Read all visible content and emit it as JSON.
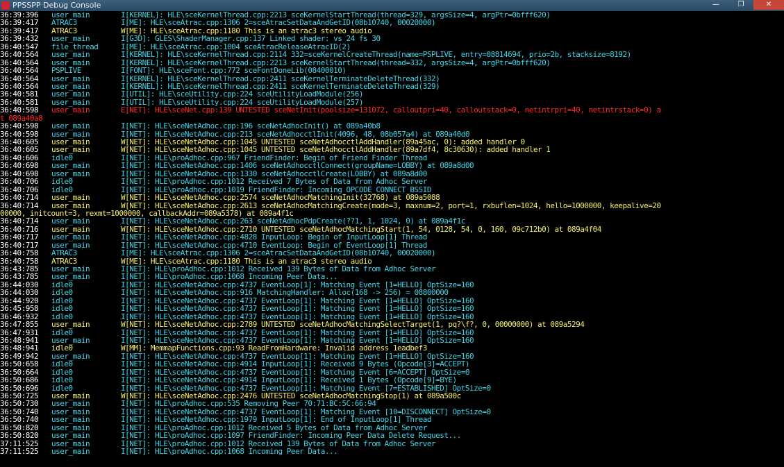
{
  "window": {
    "title": "PPSSPP Debug Console",
    "minimize": "—",
    "maximize": "❐",
    "close": "✕"
  },
  "colors": {
    "info": "#3fd5e8",
    "warning": "#f4f06a",
    "error": "#ff2a2a",
    "timestamp": "#ffffff",
    "background": "#000000"
  },
  "log": [
    {
      "ts": "36:39:396",
      "thread": "user_main",
      "msg": "I[KERNEL]: HLE\\sceKernelThread.cpp:2213 sceKernelStartThread(thread=329, argsSize=4, argPtr=0bfff620)",
      "level": "info"
    },
    {
      "ts": "36:39:417",
      "thread": "ATRAC3",
      "msg": "I[ME]: HLE\\sceAtrac.cpp:1306 2=sceAtracSetDataAndGetID(08b10740, 00020000)",
      "level": "info"
    },
    {
      "ts": "36:39:417",
      "thread": "ATRAC3",
      "msg": "W[ME]: HLE\\sceAtrac.cpp:1180 This is an atrac3 stereo audio",
      "level": "warn"
    },
    {
      "ts": "36:39:432",
      "thread": "user_main",
      "msg": "I[G3D]: GLES\\ShaderManager.cpp:137 Linked shader: vs 24 fs 30",
      "level": "info"
    },
    {
      "ts": "36:40:547",
      "thread": "file_thread",
      "msg": "I[ME]: HLE\\sceAtrac.cpp:1004 sceAtracReleaseAtracID(2)",
      "level": "info"
    },
    {
      "ts": "36:40:564",
      "thread": "user_main",
      "msg": "I[KERNEL]: HLE\\sceKernelThread.cpp:2114 332=sceKernelCreateThread(name=PSPLIVE, entry=08814694, prio=2b, stacksize=8192)",
      "level": "info"
    },
    {
      "ts": "36:40:564",
      "thread": "user_main",
      "msg": "I[KERNEL]: HLE\\sceKernelThread.cpp:2213 sceKernelStartThread(thread=332, argsSize=4, argPtr=0bfff620)",
      "level": "info"
    },
    {
      "ts": "36:40:564",
      "thread": "PSPLIVE",
      "msg": "I[FONT]: HLE\\sceFont.cpp:772 sceFontDoneLib(08400010)",
      "level": "info"
    },
    {
      "ts": "36:40:564",
      "thread": "user_main",
      "msg": "I[KERNEL]: HLE\\sceKernelThread.cpp:2411 sceKernelTerminateDeleteThread(332)",
      "level": "info"
    },
    {
      "ts": "36:40:564",
      "thread": "user_main",
      "msg": "I[KERNEL]: HLE\\sceKernelThread.cpp:2411 sceKernelTerminateDeleteThread(329)",
      "level": "info"
    },
    {
      "ts": "36:40:581",
      "thread": "user_main",
      "msg": "I[UTIL]: HLE\\sceUtility.cpp:224 sceUtilityLoadModule(256)",
      "level": "info"
    },
    {
      "ts": "36:40:581",
      "thread": "user_main",
      "msg": "I[UTIL]: HLE\\sceUtility.cpp:224 sceUtilityLoadModule(257)",
      "level": "info"
    },
    {
      "ts": "36:40:598",
      "thread": "user_main",
      "msg": "E[NET]: HLE\\sceNet.cpp:139 UNTESTED sceNetInit(poolsize=131072, calloutpri=40, calloutstack=0, netintrpri=40, netintrstack=0) a",
      "level": "err"
    },
    {
      "cont": "t 089a40a8",
      "level": "err"
    },
    {
      "ts": "36:40:598",
      "thread": "user_main",
      "msg": "I[NET]: HLE\\sceNetAdhoc.cpp:196 sceNetAdhocInit() at 089a40b8",
      "level": "info"
    },
    {
      "ts": "36:40:598",
      "thread": "user_main",
      "msg": "I[NET]: HLE\\sceNetAdhoc.cpp:213 sceNetAdhocctlInit(4096, 48, 08b057a4) at 089a40d0",
      "level": "info"
    },
    {
      "ts": "36:40:605",
      "thread": "user_main",
      "msg": "W[NET]: HLE\\sceNetAdhoc.cpp:1045 UNTESTED sceNetAdhocctlAddHandler(89a45ac, 0): added handler 0",
      "level": "warn"
    },
    {
      "ts": "36:40:605",
      "thread": "user_main",
      "msg": "W[NET]: HLE\\sceNetAdhoc.cpp:1045 UNTESTED sceNetAdhocctlAddHandler(89a7df4, 8c30630): added handler 1",
      "level": "warn"
    },
    {
      "ts": "36:40:606",
      "thread": "idle0",
      "msg": "I[NET]: HLE\\proAdhoc.cpp:967 FriendFinder: Begin of Friend Finder Thread",
      "level": "info"
    },
    {
      "ts": "36:40:698",
      "thread": "user_main",
      "msg": "I[NET]: HLE\\sceNetAdhoc.cpp:1406 sceNetAdhocctlConnect(groupName=LOBBY) at 089a8d00",
      "level": "info"
    },
    {
      "ts": "36:40:698",
      "thread": "user_main",
      "msg": "I[NET]: HLE\\sceNetAdhoc.cpp:1330 sceNetAdhocctlCreate(LOBBY) at 089a8d00",
      "level": "info"
    },
    {
      "ts": "36:40:706",
      "thread": "idle0",
      "msg": "I[NET]: HLE\\proAdhoc.cpp:1012 Received 7 Bytes of Data from Adhoc Server",
      "level": "info"
    },
    {
      "ts": "36:40:706",
      "thread": "idle0",
      "msg": "I[NET]: HLE\\proAdhoc.cpp:1019 FriendFinder: Incoming OPCODE_CONNECT_BSSID",
      "level": "info"
    },
    {
      "ts": "36:40:714",
      "thread": "user_main",
      "msg": "W[NET]: HLE\\sceNetAdhoc.cpp:2574 sceNetAdhocMatchingInit(32768) at 089a5088",
      "level": "warn"
    },
    {
      "ts": "36:40:714",
      "thread": "user_main",
      "msg": "W[NET]: HLE\\sceNetAdhoc.cpp:2613 sceNetAdhocMatchingCreate(mode=3, maxnum=2, port=1, rxbuflen=1024, hello=1000000, keepalive=20",
      "level": "warn"
    },
    {
      "cont": "00000, initcount=3, rexmt=1000000, callbackAddr=089a5378) at 089a4f1c",
      "level": "warn"
    },
    {
      "ts": "36:40:714",
      "thread": "user_main",
      "msg": "I[NET]: HLE\\sceNetAdhoc.cpp:263 sceNetAdhocPdpCreate(??1, 1, 1024, 0) at 089a4f1c",
      "level": "info"
    },
    {
      "ts": "36:40:716",
      "thread": "user_main",
      "msg": "W[NET]: HLE\\sceNetAdhoc.cpp:2710 UNTESTED sceNetAdhocMatchingStart(1, 54, 0128, 54, 0, 160, 09c712b0) at 089a4f04",
      "level": "warn"
    },
    {
      "ts": "36:40:717",
      "thread": "user_main",
      "msg": "I[NET]: HLE\\sceNetAdhoc.cpp:4828 InputLoop: Begin of InputLoop[1] Thread",
      "level": "info"
    },
    {
      "ts": "36:40:717",
      "thread": "user_main",
      "msg": "I[NET]: HLE\\sceNetAdhoc.cpp:4710 EventLoop: Begin of EventLoop[1] Thread",
      "level": "info"
    },
    {
      "ts": "36:40:758",
      "thread": "ATRAC3",
      "msg": "I[ME]: HLE\\sceAtrac.cpp:1306 2=sceAtracSetDataAndGetID(08b10740, 00020000)",
      "level": "info"
    },
    {
      "ts": "36:40:758",
      "thread": "ATRAC3",
      "msg": "W[ME]: HLE\\sceAtrac.cpp:1180 This is an atrac3 stereo audio",
      "level": "warn"
    },
    {
      "ts": "36:43:785",
      "thread": "user_main",
      "msg": "I[NET]: HLE\\proAdhoc.cpp:1012 Received 139 Bytes of Data from Adhoc Server",
      "level": "info"
    },
    {
      "ts": "36:43:785",
      "thread": "user_main",
      "msg": "I[NET]: HLE\\proAdhoc.cpp:1068 Incoming Peer Data...",
      "level": "info"
    },
    {
      "ts": "36:44:030",
      "thread": "idle0",
      "msg": "I[NET]: HLE\\sceNetAdhoc.cpp:4737 EventLoop[1]: Matching Event [1=HELLO] OptSize=160",
      "level": "info"
    },
    {
      "ts": "36:44:030",
      "thread": "idle0",
      "msg": "I[NET]: HLE\\sceNetAdhoc.cpp:916 MatchingHandler: Alloc(168 -> 256) = 08800000",
      "level": "info"
    },
    {
      "ts": "36:44:920",
      "thread": "idle0",
      "msg": "I[NET]: HLE\\sceNetAdhoc.cpp:4737 EventLoop[1]: Matching Event [1=HELLO] OptSize=160",
      "level": "info"
    },
    {
      "ts": "36:45:958",
      "thread": "idle0",
      "msg": "I[NET]: HLE\\sceNetAdhoc.cpp:4737 EventLoop[1]: Matching Event [1=HELLO] OptSize=160",
      "level": "info"
    },
    {
      "ts": "36:46:932",
      "thread": "idle0",
      "msg": "I[NET]: HLE\\sceNetAdhoc.cpp:4737 EventLoop[1]: Matching Event [1=HELLO] OptSize=160",
      "level": "info"
    },
    {
      "ts": "36:47:855",
      "thread": "user_main",
      "msg": "W[NET]: HLE\\sceNetAdhoc.cpp:2789 UNTESTED sceNetAdhocMatchingSelectTarget(1, pq?\\f?, 0, 00000000) at 089a5294",
      "level": "warn"
    },
    {
      "ts": "36:47:931",
      "thread": "idle0",
      "msg": "I[NET]: HLE\\sceNetAdhoc.cpp:4737 EventLoop[1]: Matching Event [1=HELLO] OptSize=160",
      "level": "info"
    },
    {
      "ts": "36:48:941",
      "thread": "user_main",
      "msg": "I[NET]: HLE\\sceNetAdhoc.cpp:4737 EventLoop[1]: Matching Event [1=HELLO] OptSize=160",
      "level": "info"
    },
    {
      "ts": "36:48:941",
      "thread": "idle0",
      "msg": "W[MM]: MemmapFunctions.cpp:93 ReadFromHardware: Invalid address 1eadbef3",
      "level": "warn"
    },
    {
      "ts": "36:49:942",
      "thread": "user_main",
      "msg": "I[NET]: HLE\\sceNetAdhoc.cpp:4737 EventLoop[1]: Matching Event [1=HELLO] OptSize=160",
      "level": "info"
    },
    {
      "ts": "36:50:658",
      "thread": "idle0",
      "msg": "I[NET]: HLE\\sceNetAdhoc.cpp:4914 InputLoop[1]: Received 9 Bytes (Opcode[3]=ACCEPT)",
      "level": "info"
    },
    {
      "ts": "36:50:664",
      "thread": "idle0",
      "msg": "I[NET]: HLE\\sceNetAdhoc.cpp:4737 EventLoop[1]: Matching Event [6=ACCEPT] OptSize=0",
      "level": "info"
    },
    {
      "ts": "36:50:686",
      "thread": "idle0",
      "msg": "I[NET]: HLE\\sceNetAdhoc.cpp:4914 InputLoop[1]: Received 1 Bytes (Opcode[9]=BYE)",
      "level": "info"
    },
    {
      "ts": "36:50:696",
      "thread": "idle0",
      "msg": "I[NET]: HLE\\sceNetAdhoc.cpp:4737 EventLoop[1]: Matching Event [7=ESTABLISHED] OptSize=0",
      "level": "info"
    },
    {
      "ts": "36:50:725",
      "thread": "user_main",
      "msg": "W[NET]: HLE\\sceNetAdhoc.cpp:2476 UNTESTED sceNetAdhocMatchingStop(1) at 089a500c",
      "level": "warn"
    },
    {
      "ts": "36:50:730",
      "thread": "user_main",
      "msg": "I[NET]: HLE\\proAdhoc.cpp:535 Removing Peer 70:71:BC:5C:66:94",
      "level": "info"
    },
    {
      "ts": "36:50:740",
      "thread": "user_main",
      "msg": "I[NET]: HLE\\sceNetAdhoc.cpp:4737 EventLoop[1]: Matching Event [10=DISCONNECT] OptSize=0",
      "level": "info"
    },
    {
      "ts": "36:50:740",
      "thread": "user_main",
      "msg": "I[NET]: HLE\\sceNetAdhoc.cpp:1979 InputLoop[1]: End of InputLoop[1] Thread",
      "level": "info"
    },
    {
      "ts": "36:50:820",
      "thread": "user_main",
      "msg": "I[NET]: HLE\\proAdhoc.cpp:1012 Received 5 Bytes of Data from Adhoc Server",
      "level": "info"
    },
    {
      "ts": "36:50:820",
      "thread": "user_main",
      "msg": "I[NET]: HLE\\proAdhoc.cpp:1097 FriendFinder: Incoming Peer Data Delete Request...",
      "level": "info"
    },
    {
      "ts": "37:11:525",
      "thread": "user_main",
      "msg": "I[NET]: HLE\\proAdhoc.cpp:1012 Received 139 Bytes of Data from Adhoc Server",
      "level": "info"
    },
    {
      "ts": "37:11:525",
      "thread": "user_main",
      "msg": "I[NET]: HLE\\proAdhoc.cpp:1068 Incoming Peer Data...",
      "level": "info"
    }
  ]
}
